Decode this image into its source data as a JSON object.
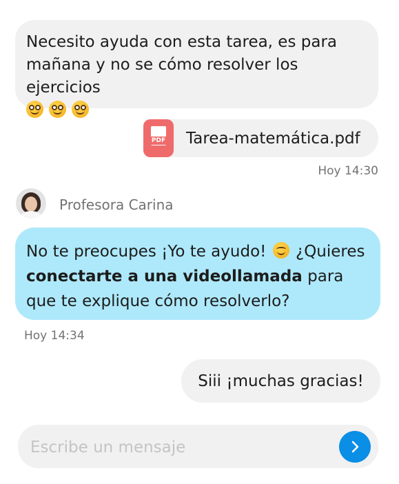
{
  "messages": {
    "first": {
      "text": "Necesito ayuda con esta tarea, es para mañana y no se cómo resolver los ejercicios",
      "emojis": [
        "woozy-face-icon",
        "woozy-face-icon",
        "woozy-face-icon"
      ]
    },
    "attachment": {
      "file_name": "Tarea-matemática.pdf",
      "icon_label": "PDF",
      "icon": "pdf-file-icon"
    },
    "first_time": "Hoy 14:30",
    "sender": {
      "name": "Profesora Carina"
    },
    "reply": {
      "part1": "No te preocupes ¡Yo te ayudo!",
      "part2": "¿Quieres",
      "bold": "conectarte a una videollamada",
      "part3": "para que te explique cómo resolverlo?"
    },
    "reply_time": "Hoy 14:34",
    "last": {
      "text": "Siii ¡muchas gracias!"
    }
  },
  "composer": {
    "placeholder": "Escribe un mensaje",
    "value": "",
    "send_icon": "chevron-right-icon"
  },
  "colors": {
    "outgoing_bubble": "#f1f1f1",
    "incoming_bubble": "#aee9fb",
    "send_button": "#0a8ee6",
    "pdf_icon": "#ef6b6b",
    "timestamp": "#727272"
  }
}
